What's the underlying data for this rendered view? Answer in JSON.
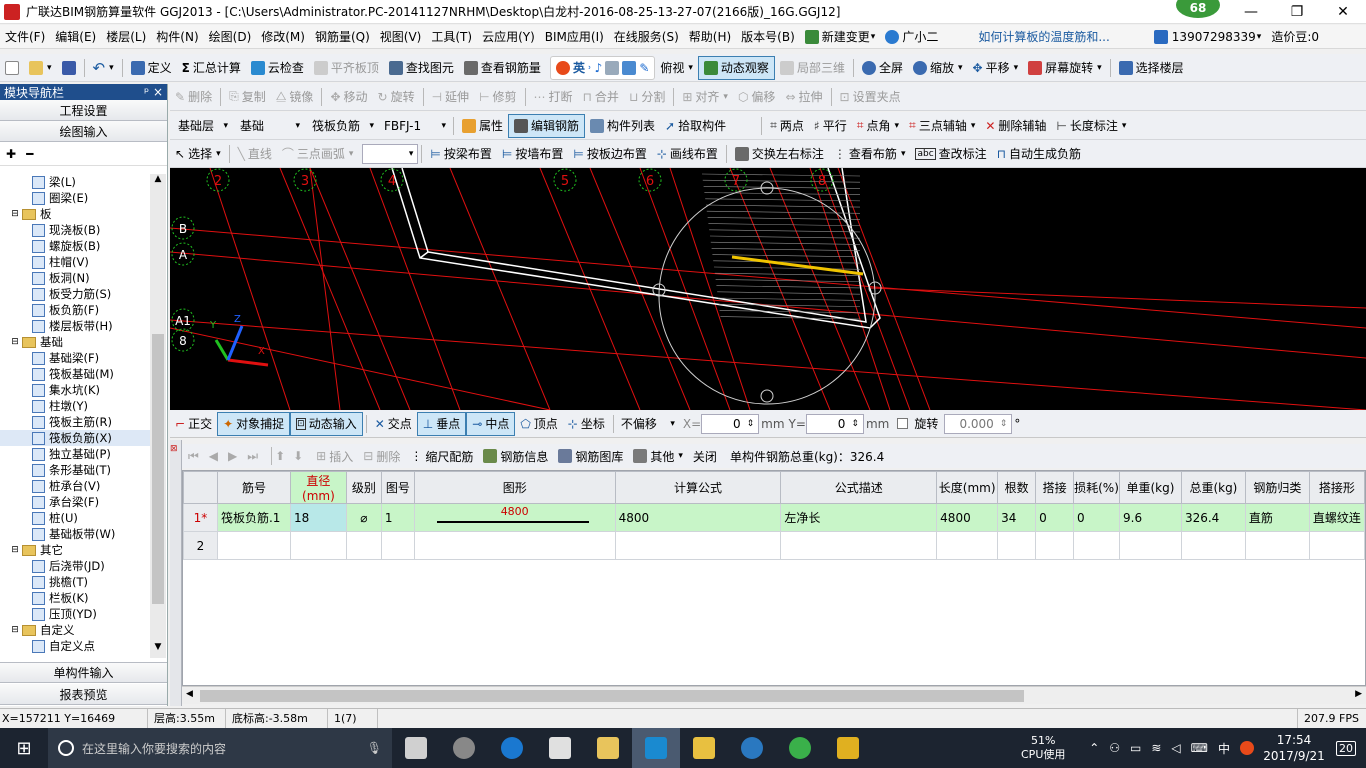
{
  "window": {
    "title": "广联达BIM钢筋算量软件 GGJ2013 - [C:\\Users\\Administrator.PC-20141127NRHM\\Desktop\\白龙村-2016-08-25-13-27-07(2166版)_16G.GGJ12]",
    "badge": "68",
    "minimize": "—",
    "restore": "❐",
    "close": "✕"
  },
  "menubar": {
    "items": [
      "文件(F)",
      "编辑(E)",
      "楼层(L)",
      "构件(N)",
      "绘图(D)",
      "修改(M)",
      "钢筋量(Q)",
      "视图(V)",
      "工具(T)",
      "云应用(Y)",
      "BIM应用(I)",
      "在线服务(S)",
      "帮助(H)",
      "版本号(B)"
    ],
    "new_change": "新建变更",
    "assistant": "广小二",
    "tip_link": "如何计算板的温度筋和...",
    "phone": "13907298339",
    "coins": "造价豆:0"
  },
  "toolbar1": {
    "define": "定义",
    "sum_calc": "汇总计算",
    "cloud_check": "云检查",
    "flush_top": "平齐板顶",
    "find_element": "查找图元",
    "view_rebar": "查看钢筋量",
    "ime_label": "英",
    "top_view": "俯视",
    "dynamic_view": "动态观察",
    "local_3d": "局部三维",
    "full_screen": "全屏",
    "zoom": "缩放",
    "pan": "平移",
    "screen_rotate": "屏幕旋转",
    "select_floor": "选择楼层"
  },
  "toolbar2": {
    "delete": "删除",
    "copy": "复制",
    "mirror": "镜像",
    "move": "移动",
    "rotate": "旋转",
    "extend": "延伸",
    "trim": "修剪",
    "break": "打断",
    "merge": "合并",
    "split": "分割",
    "align": "对齐",
    "offset": "偏移",
    "stretch": "拉伸",
    "set_grip": "设置夹点"
  },
  "toolbar3": {
    "floor": "基础层",
    "category": "基础",
    "type": "筏板负筋",
    "element": "FBFJ-1",
    "properties": "属性",
    "edit_rebar": "编辑钢筋",
    "element_list": "构件列表",
    "pick_element": "拾取构件",
    "two_points": "两点",
    "parallel": "平行",
    "point_angle": "点角",
    "three_point_axis": "三点辅轴",
    "delete_axis": "删除辅轴",
    "length_dim": "长度标注"
  },
  "toolbar4": {
    "select": "选择",
    "line": "直线",
    "arc": "三点画弧",
    "by_beam": "按梁布置",
    "by_wall": "按墙布置",
    "by_slab_edge": "按板边布置",
    "draw_line": "画线布置",
    "swap_dim": "交换左右标注",
    "view_layout": "查看布筋",
    "edit_dim": "查改标注",
    "auto_neg": "自动生成负筋"
  },
  "nav": {
    "header": "模块导航栏",
    "pin": "ᵖ ×",
    "project_settings": "工程设置",
    "drawing_input": "绘图输入",
    "single_input": "单构件输入",
    "report_preview": "报表预览",
    "tree": [
      {
        "kind": "leaf",
        "label": "梁(L)"
      },
      {
        "kind": "leaf",
        "label": "圈梁(E)"
      },
      {
        "kind": "folder",
        "label": "板"
      },
      {
        "kind": "leaf",
        "label": "现浇板(B)"
      },
      {
        "kind": "leaf",
        "label": "螺旋板(B)"
      },
      {
        "kind": "leaf",
        "label": "柱帽(V)"
      },
      {
        "kind": "leaf",
        "label": "板洞(N)"
      },
      {
        "kind": "leaf",
        "label": "板受力筋(S)"
      },
      {
        "kind": "leaf",
        "label": "板负筋(F)"
      },
      {
        "kind": "leaf",
        "label": "楼层板带(H)"
      },
      {
        "kind": "folder",
        "label": "基础"
      },
      {
        "kind": "leaf",
        "label": "基础梁(F)"
      },
      {
        "kind": "leaf",
        "label": "筏板基础(M)"
      },
      {
        "kind": "leaf",
        "label": "集水坑(K)"
      },
      {
        "kind": "leaf",
        "label": "柱墩(Y)"
      },
      {
        "kind": "leaf",
        "label": "筏板主筋(R)"
      },
      {
        "kind": "leaf",
        "label": "筏板负筋(X)",
        "selected": true
      },
      {
        "kind": "leaf",
        "label": "独立基础(P)"
      },
      {
        "kind": "leaf",
        "label": "条形基础(T)"
      },
      {
        "kind": "leaf",
        "label": "桩承台(V)"
      },
      {
        "kind": "leaf",
        "label": "承台梁(F)"
      },
      {
        "kind": "leaf",
        "label": "桩(U)"
      },
      {
        "kind": "leaf",
        "label": "基础板带(W)"
      },
      {
        "kind": "folder",
        "label": "其它"
      },
      {
        "kind": "leaf",
        "label": "后浇带(JD)"
      },
      {
        "kind": "leaf",
        "label": "挑檐(T)"
      },
      {
        "kind": "leaf",
        "label": "栏板(K)"
      },
      {
        "kind": "leaf",
        "label": "压顶(YD)"
      },
      {
        "kind": "folder",
        "label": "自定义"
      },
      {
        "kind": "leaf",
        "label": "自定义点"
      }
    ]
  },
  "canvas": {
    "axis_numbers": [
      "2",
      "3",
      "4",
      "5",
      "6",
      "7",
      "8"
    ],
    "axis_letters": [
      "B",
      "A",
      "A1",
      "8"
    ],
    "rebar_color": "#f0c400",
    "grid_color": "#e01010"
  },
  "snapbar": {
    "ortho": "正交",
    "object_snap": "对象捕捉",
    "dynamic_input": "动态输入",
    "intersection": "交点",
    "perpendicular": "垂点",
    "midpoint": "中点",
    "vertex": "顶点",
    "coordinate": "坐标",
    "offset_mode": "不偏移",
    "x_label": "X=",
    "x_value": "0",
    "y_label": "Y=",
    "y_value": "0",
    "unit": "mm",
    "rotate_label": "旋转",
    "rotate_value": "0.000",
    "degree": "°"
  },
  "grid_toolbar": {
    "insert": "插入",
    "delete": "删除",
    "scale_rebar": "缩尺配筋",
    "rebar_info": "钢筋信息",
    "rebar_library": "钢筋图库",
    "other": "其他",
    "close": "关闭",
    "total_weight": "单构件钢筋总重(kg)：326.4"
  },
  "grid": {
    "columns": [
      "",
      "筋号",
      "直径(mm)",
      "级别",
      "图号",
      "图形",
      "计算公式",
      "公式描述",
      "长度(mm)",
      "根数",
      "搭接",
      "损耗(%)",
      "单重(kg)",
      "总重(kg)",
      "钢筋归类",
      "搭接形"
    ],
    "rows": [
      {
        "idx": "1*",
        "name": "筏板负筋.1",
        "diameter": "18",
        "grade": "⌀",
        "fig": "1",
        "shape_value": "4800",
        "formula": "4800",
        "desc": "左净长",
        "length": "4800",
        "count": "34",
        "lap": "0",
        "loss": "0",
        "unit_weight": "9.6",
        "total_weight": "326.4",
        "category": "直筋",
        "lap_type": "直螺纹连"
      },
      {
        "idx": "2",
        "name": "",
        "diameter": "",
        "grade": "",
        "fig": "",
        "shape_value": "",
        "formula": "",
        "desc": "",
        "length": "",
        "count": "",
        "lap": "",
        "loss": "",
        "unit_weight": "",
        "total_weight": "",
        "category": "",
        "lap_type": ""
      }
    ]
  },
  "statusbar": {
    "coords": "X=157211 Y=16469",
    "floor_height": "层高:3.55m",
    "bottom_height": "底标高:-3.58m",
    "count": "1(7)",
    "fps": "207.9 FPS"
  },
  "taskbar": {
    "search_placeholder": "在这里输入你要搜索的内容",
    "cpu_percent": "51%",
    "cpu_label": "CPU使用",
    "ime": "中",
    "time": "17:54",
    "date": "2017/9/21",
    "notifications": "20"
  }
}
